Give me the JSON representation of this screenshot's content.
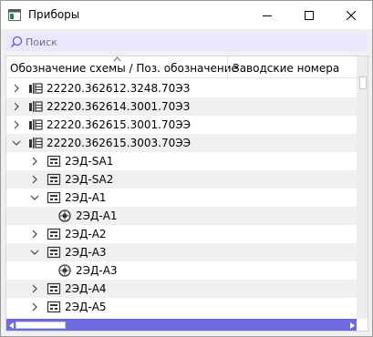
{
  "window": {
    "title": "Приборы",
    "controls": {
      "minimize": "minimize-icon",
      "maximize": "maximize-icon",
      "close": "close-icon"
    }
  },
  "search": {
    "placeholder": "Поиск",
    "value": ""
  },
  "columns": [
    {
      "label": "Обозначение схемы / Поз. обозначение",
      "sorted": "ascending"
    },
    {
      "label": "Заводские номера"
    }
  ],
  "rows": [
    {
      "label": "22220.362612.3248.70ЭЗ",
      "level": 0,
      "expanded": false,
      "icon": "scheme-icon"
    },
    {
      "label": "22220.362614.3001.70ЭЗ",
      "level": 0,
      "expanded": false,
      "icon": "scheme-icon"
    },
    {
      "label": "22220.362615.3001.70ЭЭ",
      "level": 0,
      "expanded": false,
      "icon": "scheme-icon"
    },
    {
      "label": "22220.362615.3003.70ЭЭ",
      "level": 0,
      "expanded": true,
      "icon": "scheme-icon"
    },
    {
      "label": "2ЭД-SA1",
      "level": 1,
      "expanded": false,
      "icon": "device-icon"
    },
    {
      "label": "2ЭД-SA2",
      "level": 1,
      "expanded": false,
      "icon": "device-icon"
    },
    {
      "label": "2ЭД-A1",
      "level": 1,
      "expanded": true,
      "icon": "device-icon"
    },
    {
      "label": "2ЭД-A1",
      "level": 2,
      "leaf": true,
      "icon": "component-icon"
    },
    {
      "label": "2ЭД-A2",
      "level": 1,
      "expanded": false,
      "icon": "device-icon"
    },
    {
      "label": "2ЭД-A3",
      "level": 1,
      "expanded": true,
      "icon": "device-icon"
    },
    {
      "label": "2ЭД-A3",
      "level": 2,
      "leaf": true,
      "icon": "component-icon"
    },
    {
      "label": "2ЭД-A4",
      "level": 1,
      "expanded": false,
      "icon": "device-icon"
    },
    {
      "label": "2ЭД-A5",
      "level": 1,
      "expanded": false,
      "icon": "device-icon"
    }
  ],
  "colors": {
    "search_bg": "#eae7ff",
    "hscroll": "#6f69e0",
    "alt_row": "#f0f0f0"
  }
}
